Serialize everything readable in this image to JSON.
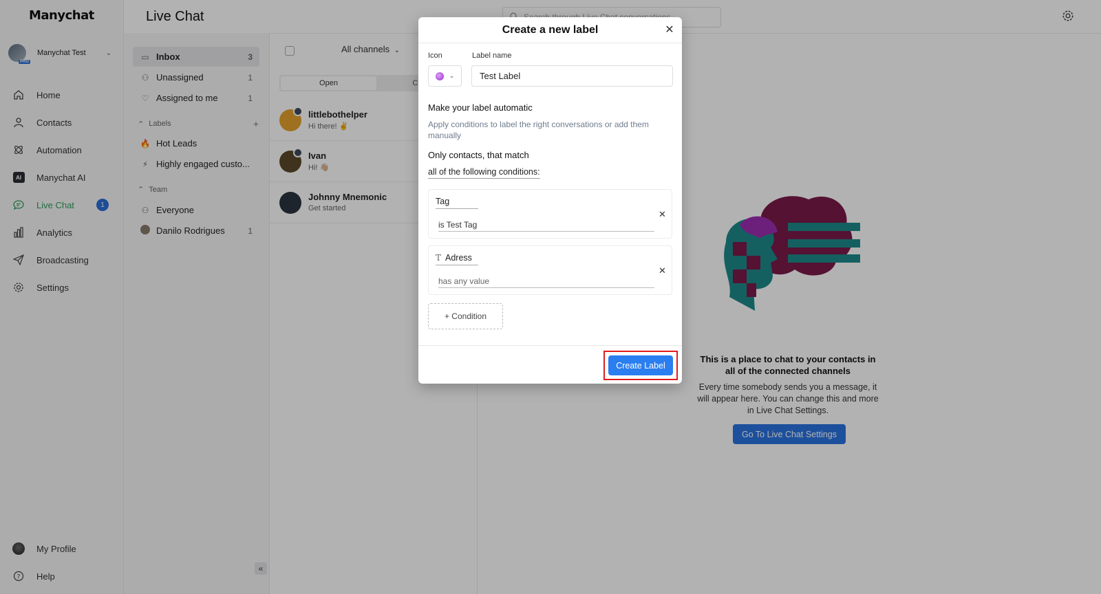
{
  "app": {
    "brand": "Manychat",
    "title": "Live Chat",
    "search_placeholder": "Search through Live Chat conversations"
  },
  "account": {
    "name": "Manychat Test",
    "badge": "PRO"
  },
  "nav": [
    {
      "label": "Home",
      "icon": "home-icon"
    },
    {
      "label": "Contacts",
      "icon": "person-icon"
    },
    {
      "label": "Automation",
      "icon": "automation-icon"
    },
    {
      "label": "Manychat AI",
      "icon": "ai-icon"
    },
    {
      "label": "Live Chat",
      "icon": "chat-icon",
      "badge": "1"
    },
    {
      "label": "Analytics",
      "icon": "bar-chart-icon"
    },
    {
      "label": "Broadcasting",
      "icon": "send-icon"
    },
    {
      "label": "Settings",
      "icon": "gear-icon"
    }
  ],
  "nav_bottom": [
    {
      "label": "My Profile"
    },
    {
      "label": "Help"
    }
  ],
  "ai_icon_text": "AI",
  "inbox": {
    "items": [
      {
        "label": "Inbox",
        "count": "3"
      },
      {
        "label": "Unassigned",
        "count": "1"
      },
      {
        "label": "Assigned to me",
        "count": "1"
      }
    ],
    "labels_header": "Labels",
    "labels": [
      {
        "label": "Hot Leads",
        "emoji": "🔥"
      },
      {
        "label": "Highly engaged custo...",
        "emoji": "⚡"
      }
    ],
    "team_header": "Team",
    "team": [
      {
        "label": "Everyone",
        "count": ""
      },
      {
        "label": "Danilo Rodrigues",
        "count": "1"
      }
    ]
  },
  "conversations": {
    "channel_filter": "All channels",
    "tabs": [
      "Open",
      "Closed"
    ],
    "items": [
      {
        "name": "littlebothelper",
        "message": "Hi there! ✌️"
      },
      {
        "name": "Ivan",
        "message": "Hi! 👋🏼"
      },
      {
        "name": "Johnny Mnemonic",
        "message": "Get started"
      }
    ]
  },
  "empty_state": {
    "heading": "This is a place to chat to your contacts in all of the connected channels",
    "body": "Every time somebody sends you a message, it will appear here. You can change this and more in Live Chat Settings.",
    "button": "Go To Live Chat Settings"
  },
  "modal": {
    "title": "Create a new label",
    "icon_label": "Icon",
    "name_label": "Label name",
    "name_value": "Test Label",
    "auto_title": "Make your label automatic",
    "auto_desc": "Apply conditions to label the right conversations or add them manually",
    "match_title": "Only contacts, that match",
    "match_select": "all of the following conditions:",
    "conditions": [
      {
        "field": "Tag",
        "value": "is Test Tag"
      },
      {
        "field": "Adress",
        "value": "has any value",
        "type_icon": "T"
      }
    ],
    "add_condition": "+ Condition",
    "create_button": "Create Label"
  },
  "colors": {
    "accent": "#2a7ef0",
    "live_chat_green": "#2f9e5a",
    "highlight": "#e11b1b",
    "illus_maroon": "#7a1a4a",
    "illus_teal": "#1e8a8a"
  }
}
